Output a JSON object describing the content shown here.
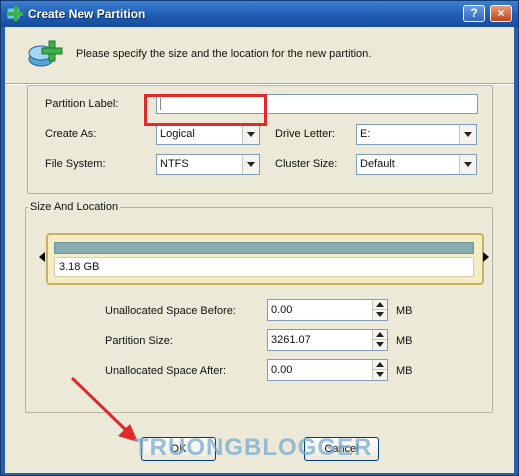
{
  "window": {
    "title": "Create New Partition",
    "help_label": "?",
    "close_label": "×"
  },
  "instruction": "Please specify the size and the location for the new partition.",
  "fields": {
    "partition_label": {
      "label": "Partition Label:",
      "value": ""
    },
    "create_as": {
      "label": "Create As:",
      "value": "Logical"
    },
    "drive_letter": {
      "label": "Drive Letter:",
      "value": "E:"
    },
    "file_system": {
      "label": "File System:",
      "value": "NTFS"
    },
    "cluster_size": {
      "label": "Cluster Size:",
      "value": "Default"
    }
  },
  "size_location": {
    "group_label": "Size And Location",
    "disk_size_label": "3.18 GB",
    "unallocated_before": {
      "label": "Unallocated Space Before:",
      "value": "0.00",
      "unit": "MB"
    },
    "partition_size": {
      "label": "Partition Size:",
      "value": "3261.07",
      "unit": "MB"
    },
    "unallocated_after": {
      "label": "Unallocated Space After:",
      "value": "0.00",
      "unit": "MB"
    }
  },
  "buttons": {
    "ok": "OK",
    "cancel": "Cancel"
  },
  "watermark": "TRUONGBLOGGER",
  "colors": {
    "highlight": "#e0292b",
    "titlebar": "#1f5cb3",
    "disk_bar": "#88aeb2"
  }
}
